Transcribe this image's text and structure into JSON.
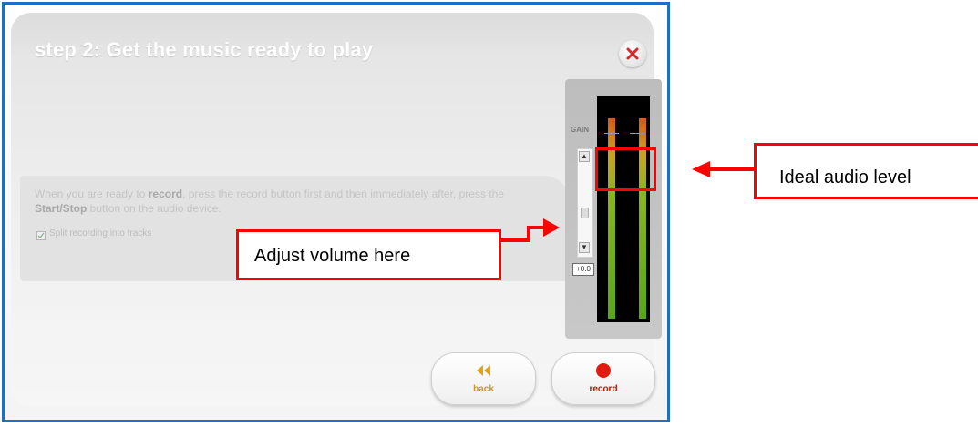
{
  "dialog": {
    "title": "step 2: Get the music ready to play",
    "close_icon": "close-icon",
    "instruction": {
      "part1": "When you are ready to ",
      "bold1": "record",
      "part2": ", press the record button first and then immediately after, press the ",
      "bold2": "Start/Stop",
      "part3": " button on the audio device."
    },
    "split_tracks_label": "Split recording into tracks",
    "split_tracks_checked": true
  },
  "gain": {
    "label": "GAIN",
    "value": "+0.0",
    "up_icon": "chevron-up-icon",
    "down_icon": "chevron-down-icon"
  },
  "buttons": {
    "back_label": "back",
    "back_icon": "rewind-icon",
    "record_label": "record",
    "record_icon": "record-dot-icon"
  },
  "annotations": {
    "adjust_volume": "Adjust volume here",
    "ideal_level": "Ideal audio level"
  },
  "colors": {
    "frame": "#1d6fc4",
    "annotation": "#ff0000",
    "back_label": "#c99a1a",
    "record_label": "#c0180a",
    "record_dot": "#e31a10"
  }
}
